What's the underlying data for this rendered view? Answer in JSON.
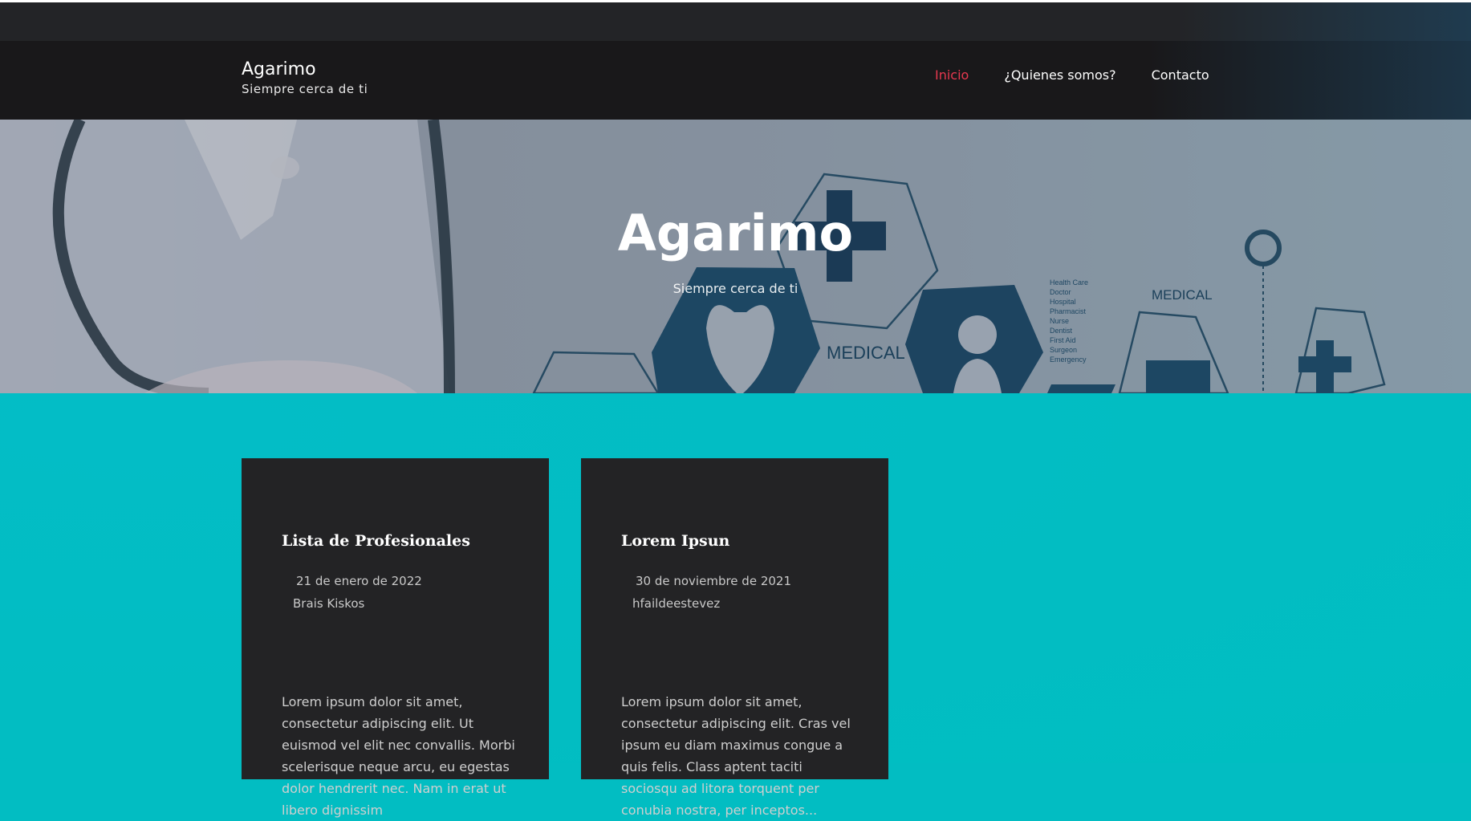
{
  "header": {
    "site_title": "Agarimo",
    "tagline": "Siempre cerca de ti"
  },
  "nav": {
    "items": [
      {
        "label": "Inicio",
        "active": true
      },
      {
        "label": "¿Quienes somos?",
        "active": false
      },
      {
        "label": "Contacto",
        "active": false
      }
    ]
  },
  "hero": {
    "title": "Agarimo",
    "subtitle": "Siempre cerca de ti",
    "image_labels": {
      "medical_main": "MEDICAL",
      "medical_small": "MEDICAL",
      "list": [
        "Health Care",
        "Doctor",
        "Hospital",
        "Pharmacist",
        "Nurse",
        "Dentist",
        "First Aid",
        "Surgeon",
        "Emergency"
      ]
    }
  },
  "posts": [
    {
      "title": "Lista de Profesionales",
      "date": "21 de enero de 2022",
      "author": "Brais Kiskos",
      "excerpt": "Lorem ipsum dolor sit amet, consectetur adipiscing elit. Ut euismod vel elit nec convallis. Morbi scelerisque neque arcu, eu egestas dolor hendrerit nec. Nam in erat ut libero dignissim"
    },
    {
      "title": "Lorem Ipsun",
      "date": "30 de noviembre de 2021",
      "author": "hfaildeestevez",
      "excerpt": "Lorem ipsum dolor sit amet, consectetur adipiscing elit. Cras vel ipsum eu diam maximus congue a quis felis. Class aptent taciti sociosqu ad litora torquent per conubia nostra, per inceptos..."
    }
  ],
  "colors": {
    "accent_nav": "#e8384f",
    "content_bg": "#02bdc2",
    "card_bg": "#232325",
    "navbar_bg": "#19181a"
  }
}
